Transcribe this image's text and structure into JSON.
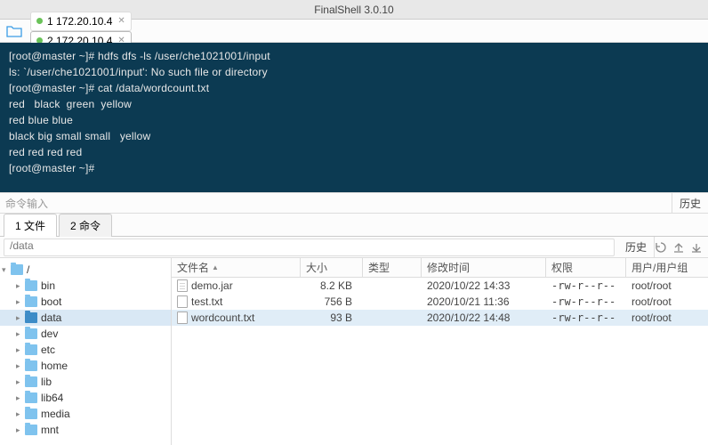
{
  "window": {
    "title": "FinalShell 3.0.10"
  },
  "conn_tabs": [
    {
      "label": "1 172.20.10.4",
      "active": false
    },
    {
      "label": "2 172.20.10.4",
      "active": true
    }
  ],
  "terminal_lines": [
    "[root@master ~]# hdfs dfs -ls /user/che1021001/input",
    "ls: `/user/che1021001/input': No such file or directory",
    "[root@master ~]# cat /data/wordcount.txt",
    "red   black  green  yellow",
    "red blue blue",
    "black big small small   yellow",
    "red red red red",
    "[root@master ~]#"
  ],
  "cmd_input": {
    "placeholder": "命令输入",
    "history_label": "历史"
  },
  "mid_tabs": [
    {
      "label": "1 文件",
      "active": true
    },
    {
      "label": "2 命令",
      "active": false
    }
  ],
  "path_bar": {
    "path": "/data",
    "history_label": "历史"
  },
  "tree": [
    {
      "label": "/",
      "root": true
    },
    {
      "label": "bin"
    },
    {
      "label": "boot"
    },
    {
      "label": "data",
      "selected": true
    },
    {
      "label": "dev"
    },
    {
      "label": "etc"
    },
    {
      "label": "home"
    },
    {
      "label": "lib"
    },
    {
      "label": "lib64"
    },
    {
      "label": "media"
    },
    {
      "label": "mnt"
    }
  ],
  "list_header": {
    "name": "文件名",
    "size": "大小",
    "type": "类型",
    "mtime": "修改时间",
    "perm": "权限",
    "owner": "用户/用户组"
  },
  "files": [
    {
      "name": "demo.jar",
      "size": "8.2 KB",
      "type": "",
      "mtime": "2020/10/22 14:33",
      "perm": "-rw-r--r--",
      "owner": "root/root",
      "icon": "jar"
    },
    {
      "name": "test.txt",
      "size": "756 B",
      "type": "",
      "mtime": "2020/10/21 11:36",
      "perm": "-rw-r--r--",
      "owner": "root/root",
      "icon": "txt"
    },
    {
      "name": "wordcount.txt",
      "size": "93 B",
      "type": "",
      "mtime": "2020/10/22 14:48",
      "perm": "-rw-r--r--",
      "owner": "root/root",
      "icon": "txt",
      "selected": true
    }
  ]
}
